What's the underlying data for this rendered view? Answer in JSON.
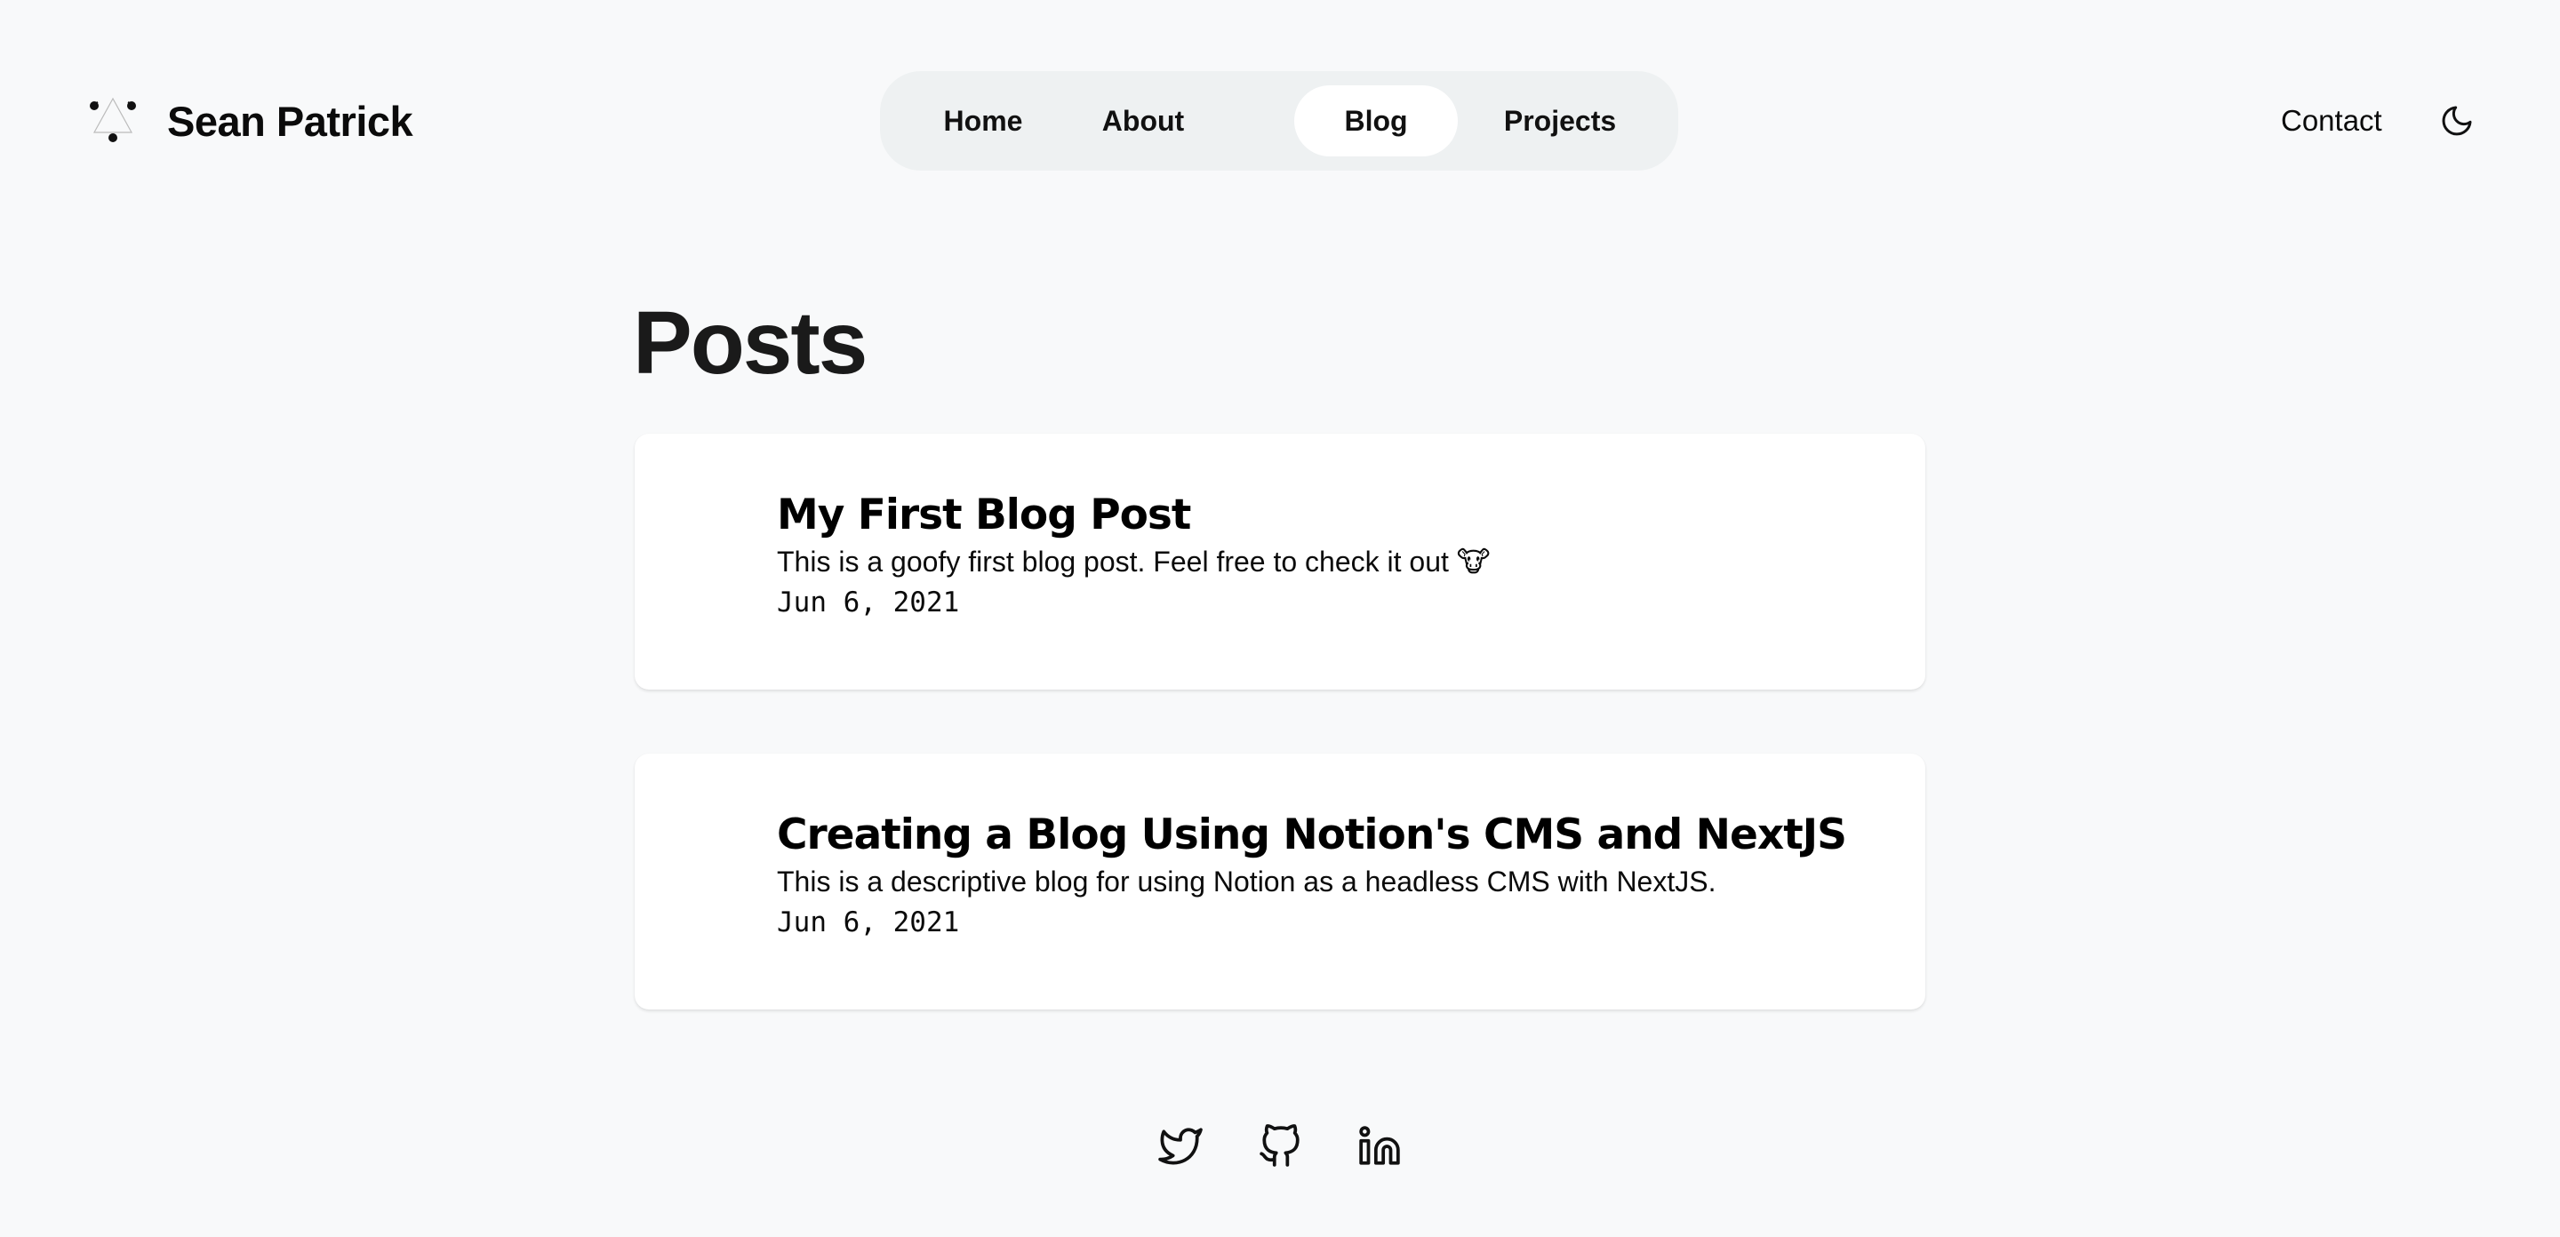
{
  "header": {
    "brand_name": "Sean Patrick",
    "nav": [
      {
        "label": "Home",
        "active": false
      },
      {
        "label": "About",
        "active": false
      },
      {
        "label": "Blog",
        "active": true
      },
      {
        "label": "Projects",
        "active": false
      }
    ],
    "contact_label": "Contact",
    "theme_icon": "moon-icon"
  },
  "main": {
    "title": "Posts",
    "posts": [
      {
        "title": "My First Blog Post",
        "description": "This is a goofy first blog post. Feel free to check it out 🐮",
        "date": "Jun 6, 2021"
      },
      {
        "title": "Creating a Blog Using Notion's CMS and NextJS",
        "description": "This is a descriptive blog for using Notion as a headless CMS with NextJS.",
        "date": "Jun 6, 2021"
      }
    ]
  },
  "footer": {
    "social_icons": [
      "twitter-icon",
      "github-icon",
      "linkedin-icon"
    ]
  },
  "colors": {
    "background": "#f8f9fa",
    "nav_background": "#eef1f2",
    "active_pill": "#ffffff",
    "card_background": "#ffffff",
    "text": "#0b0b0b"
  }
}
